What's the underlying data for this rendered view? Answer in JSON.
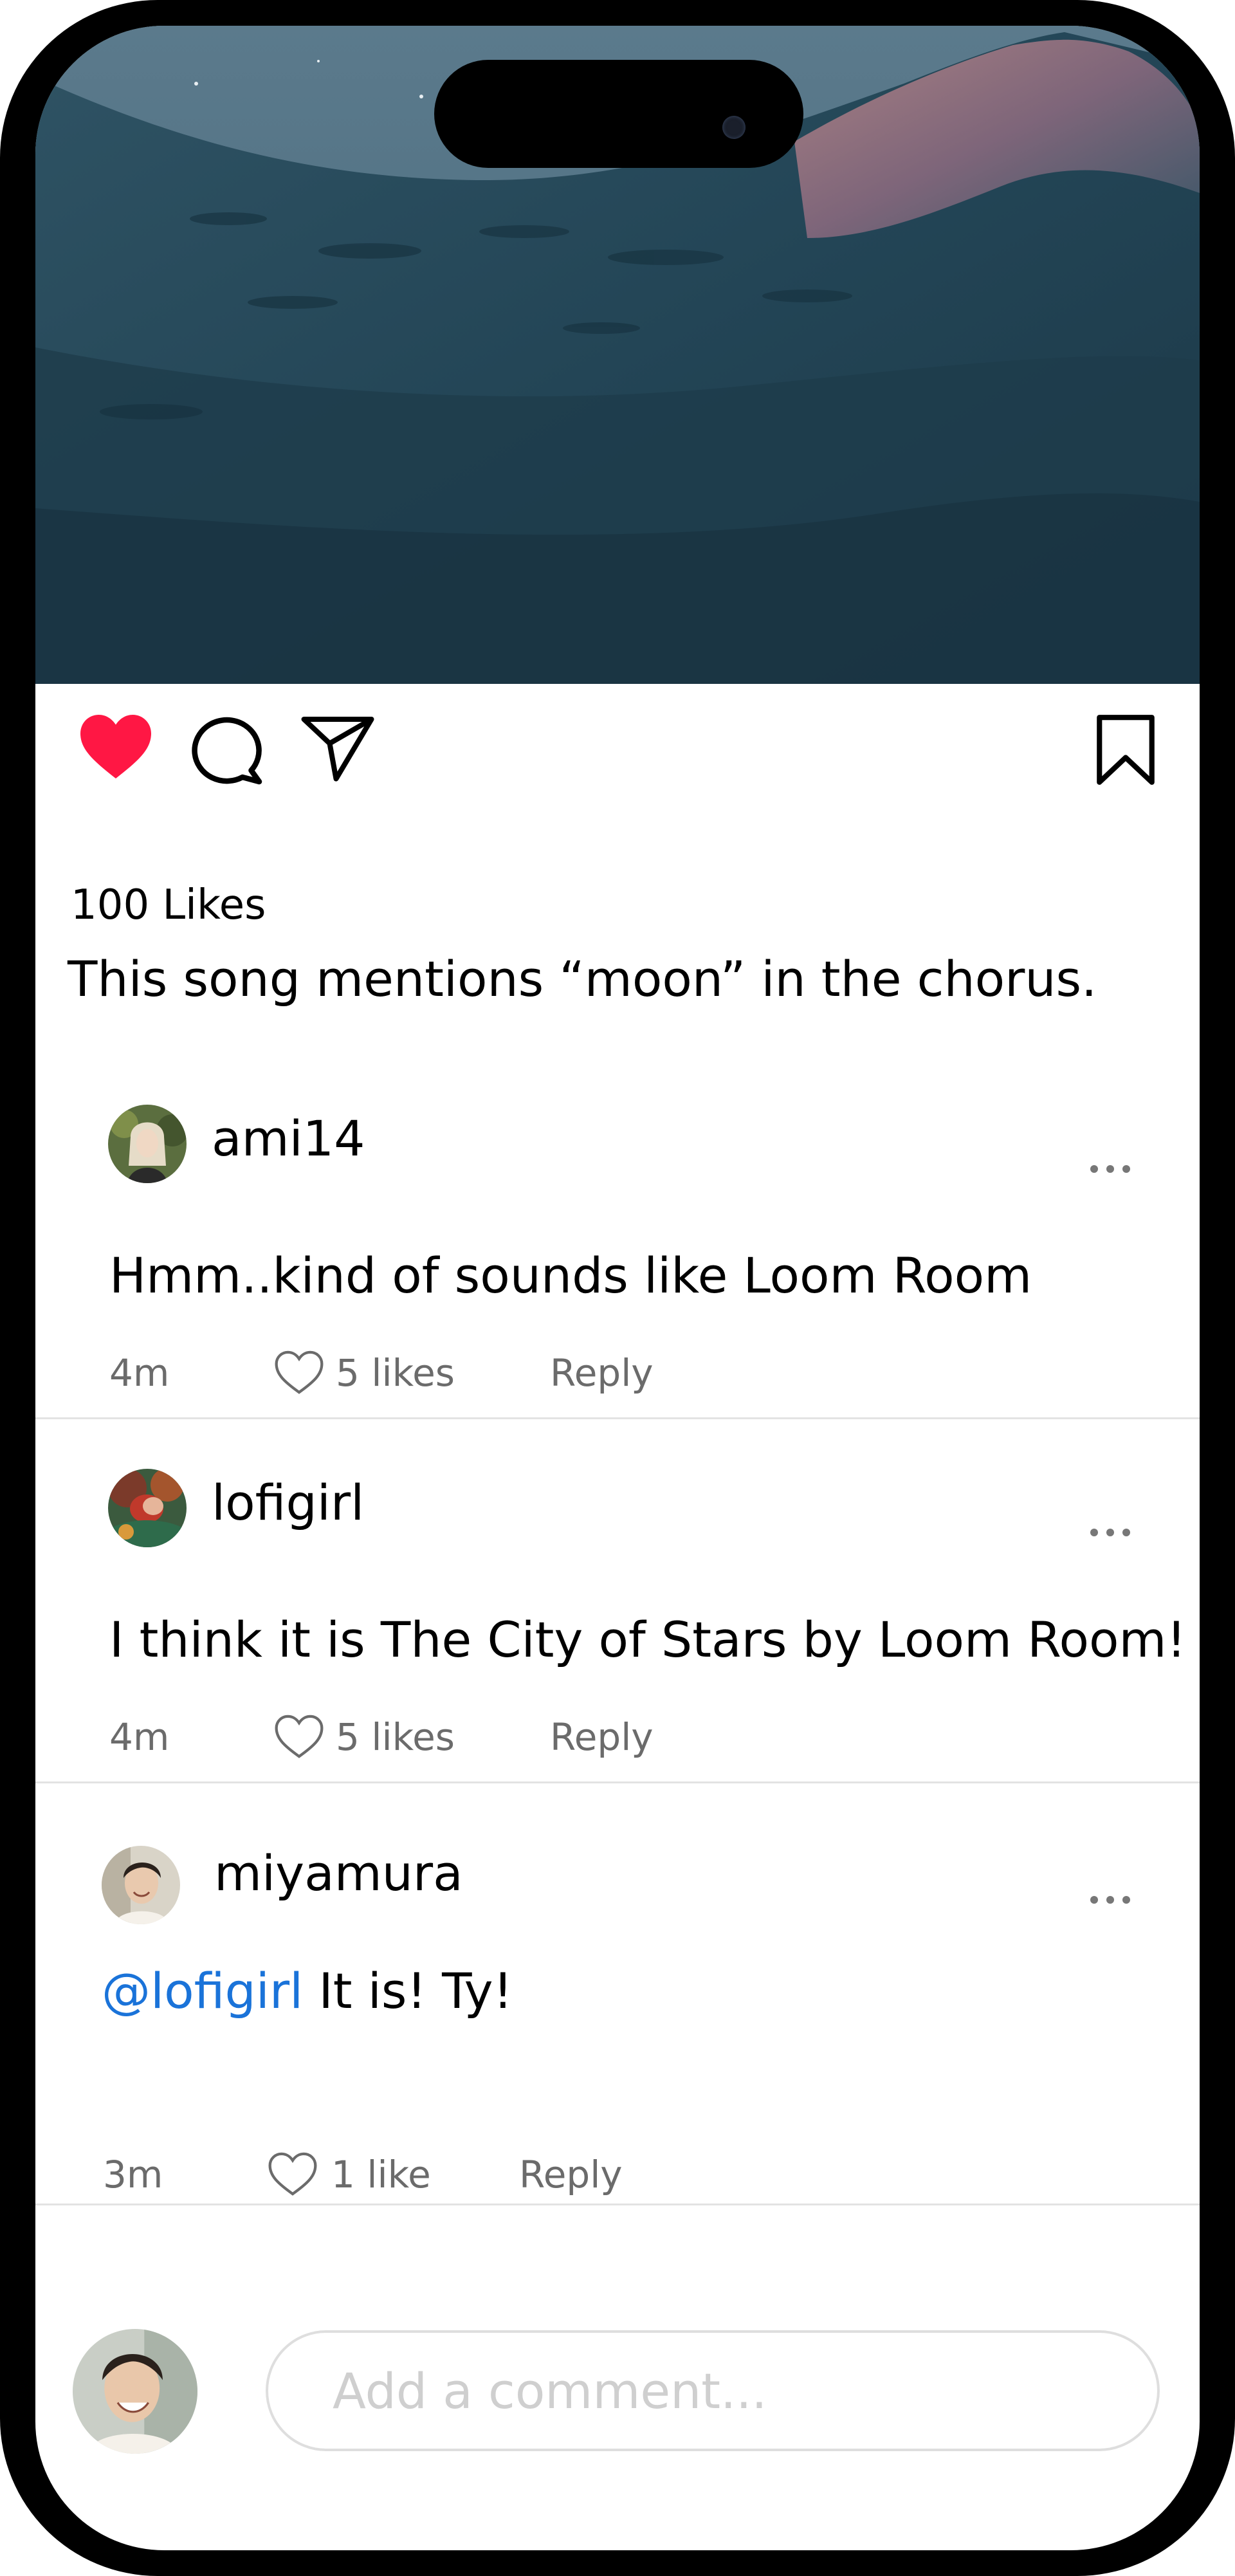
{
  "post": {
    "likes_label": "100 Likes",
    "caption": "This song mentions “moon” in the chorus."
  },
  "icons": {
    "like": "heart-filled-icon",
    "comment": "comment-bubble-icon",
    "share": "paper-plane-icon",
    "save": "bookmark-icon",
    "more": "more-dots-icon",
    "comment_like": "heart-outline-icon"
  },
  "colors": {
    "like_red": "#ff1744",
    "mention_blue": "#1a73d9",
    "meta_gray": "#6b6b6b"
  },
  "comments": [
    {
      "username": "ami14",
      "text": "Hmm..kind of sounds like Loom Room",
      "time": "4m",
      "likes": "5 likes",
      "reply": "Reply"
    },
    {
      "username": "lofigirl",
      "text": "I think it is The City of Stars by Loom Room!",
      "time": "4m",
      "likes": "5 likes",
      "reply": "Reply"
    },
    {
      "username": "miyamura",
      "mention": "@lofigirl",
      "text": " It is! Ty!",
      "time": "3m",
      "likes": "1 like",
      "reply": "Reply"
    }
  ],
  "composer": {
    "placeholder": "Add a comment..."
  }
}
